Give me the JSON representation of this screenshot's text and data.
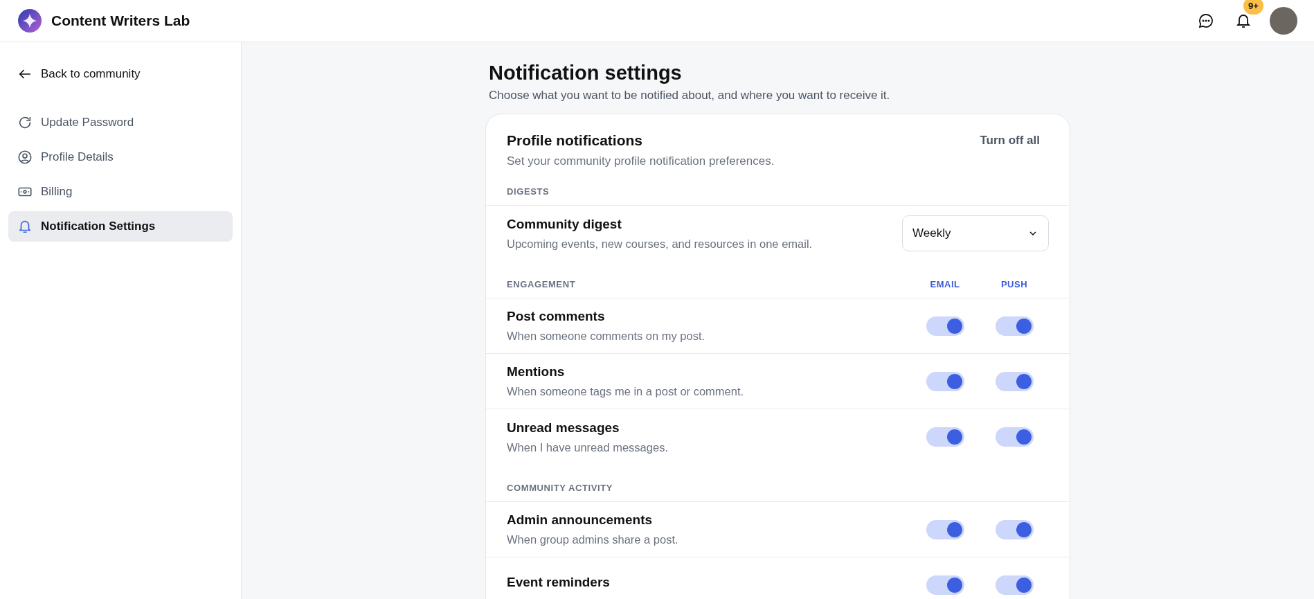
{
  "header": {
    "title": "Content Writers Lab",
    "notification_badge": "9+"
  },
  "sidebar": {
    "back": "Back to community",
    "items": [
      {
        "label": "Update Password",
        "selected": false
      },
      {
        "label": "Profile Details",
        "selected": false
      },
      {
        "label": "Billing",
        "selected": false
      },
      {
        "label": "Notification Settings",
        "selected": true
      }
    ]
  },
  "page": {
    "title": "Notification settings",
    "subtitle": "Choose what you want to be notified about, and where you want to receive it."
  },
  "card": {
    "title": "Profile notifications",
    "description": "Set your community profile notification preferences.",
    "action": "Turn off all",
    "sections": [
      {
        "heading": "DIGESTS",
        "rows": [
          {
            "kind": "select",
            "title": "Community digest",
            "description": "Upcoming events, new courses, and resources in one email.",
            "value": "Weekly"
          }
        ]
      },
      {
        "heading": "ENGAGEMENT",
        "columns": [
          "EMAIL",
          "PUSH"
        ],
        "rows": [
          {
            "kind": "toggles",
            "title": "Post comments",
            "description": "When someone comments on my post.",
            "email": true,
            "push": true
          },
          {
            "kind": "toggles",
            "title": "Mentions",
            "description": "When someone tags me in a post or comment.",
            "email": true,
            "push": true
          },
          {
            "kind": "toggles",
            "title": "Unread messages",
            "description": "When I have unread messages.",
            "email": true,
            "push": true
          }
        ]
      },
      {
        "heading": "COMMUNITY ACTIVITY",
        "rows": [
          {
            "kind": "toggles",
            "title": "Admin announcements",
            "description": "When group admins share a post.",
            "email": true,
            "push": true
          },
          {
            "kind": "toggles",
            "title": "Event reminders",
            "email": true,
            "push": true
          }
        ]
      }
    ]
  }
}
